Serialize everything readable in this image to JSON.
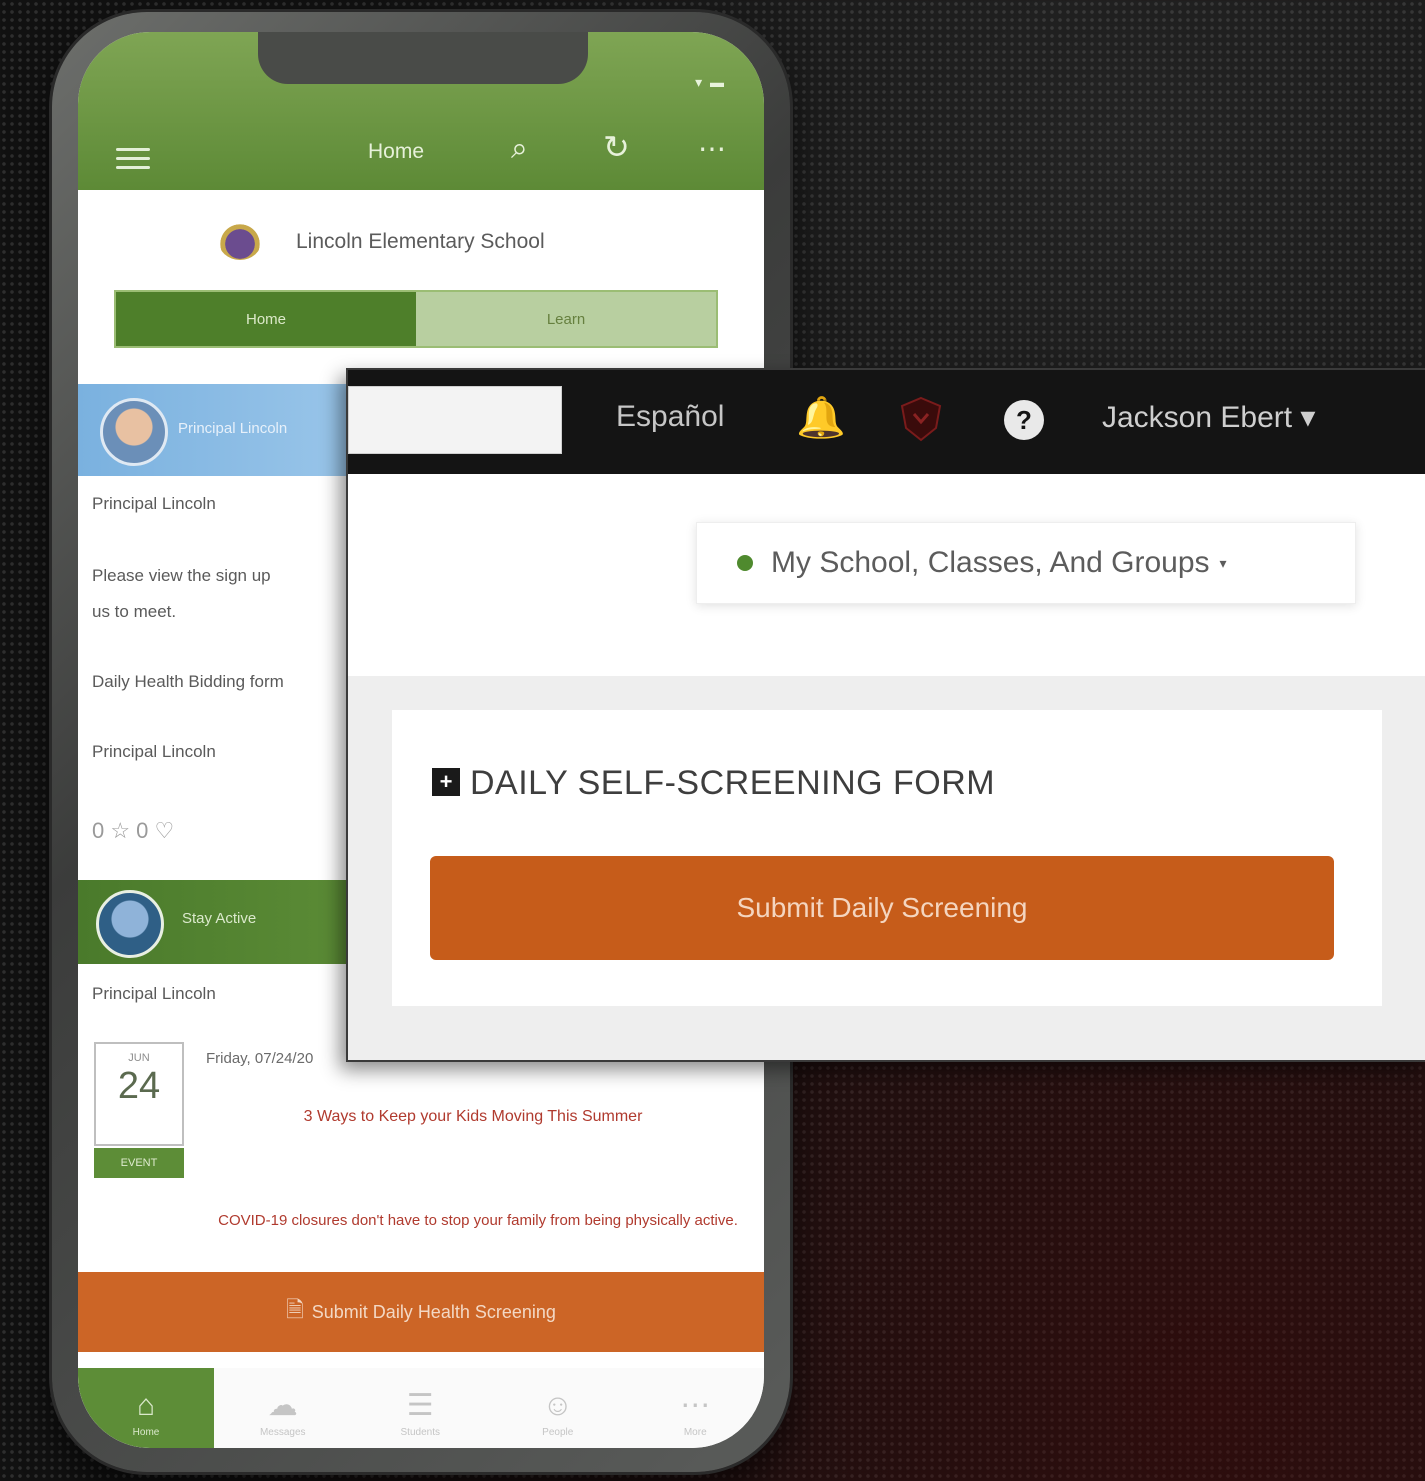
{
  "phone": {
    "status": "▾ ▬",
    "header_title": "Home",
    "school_name": "Lincoln Elementary School",
    "tabs": [
      "Home",
      "Learn"
    ],
    "post1": {
      "author": "Principal Lincoln",
      "subauthor": "Principal Lincoln",
      "line1": "Please view the sign up",
      "line2": "us to meet.",
      "line3": "Daily Health Bidding form",
      "signature": "Principal Lincoln",
      "reactions": "0 ☆ 0 ♡"
    },
    "post2": {
      "author": "Stay Active",
      "subauthor": "Principal Lincoln",
      "calendar_month": "JUN",
      "calendar_day": "24",
      "calendar_badge": "EVENT",
      "date_text": "Friday, 07/24/20",
      "event_title": "3 Ways to Keep your Kids Moving This Summer",
      "event_body": "COVID-19 closures don't have to stop your family from being physically active."
    },
    "submit_bar": "Submit Daily Health Screening",
    "nav": [
      {
        "icon": "⌂",
        "label": "Home"
      },
      {
        "icon": "☁",
        "label": "Messages"
      },
      {
        "icon": "☰",
        "label": "Students"
      },
      {
        "icon": "☺",
        "label": "People"
      },
      {
        "icon": "⋯",
        "label": "More"
      }
    ]
  },
  "web": {
    "language": "Español",
    "user_name": "Jackson Ebert ▾",
    "scope_label": "My School, Classes, And Groups",
    "scope_caret": "▾",
    "form_icon": "+",
    "form_title": "DAILY SELF-SCREENING FORM",
    "submit_label": "Submit Daily Screening"
  },
  "colors": {
    "phone_header": "#6a9740",
    "submit_orange": "#c65c1a",
    "web_top_bar": "#141414"
  }
}
